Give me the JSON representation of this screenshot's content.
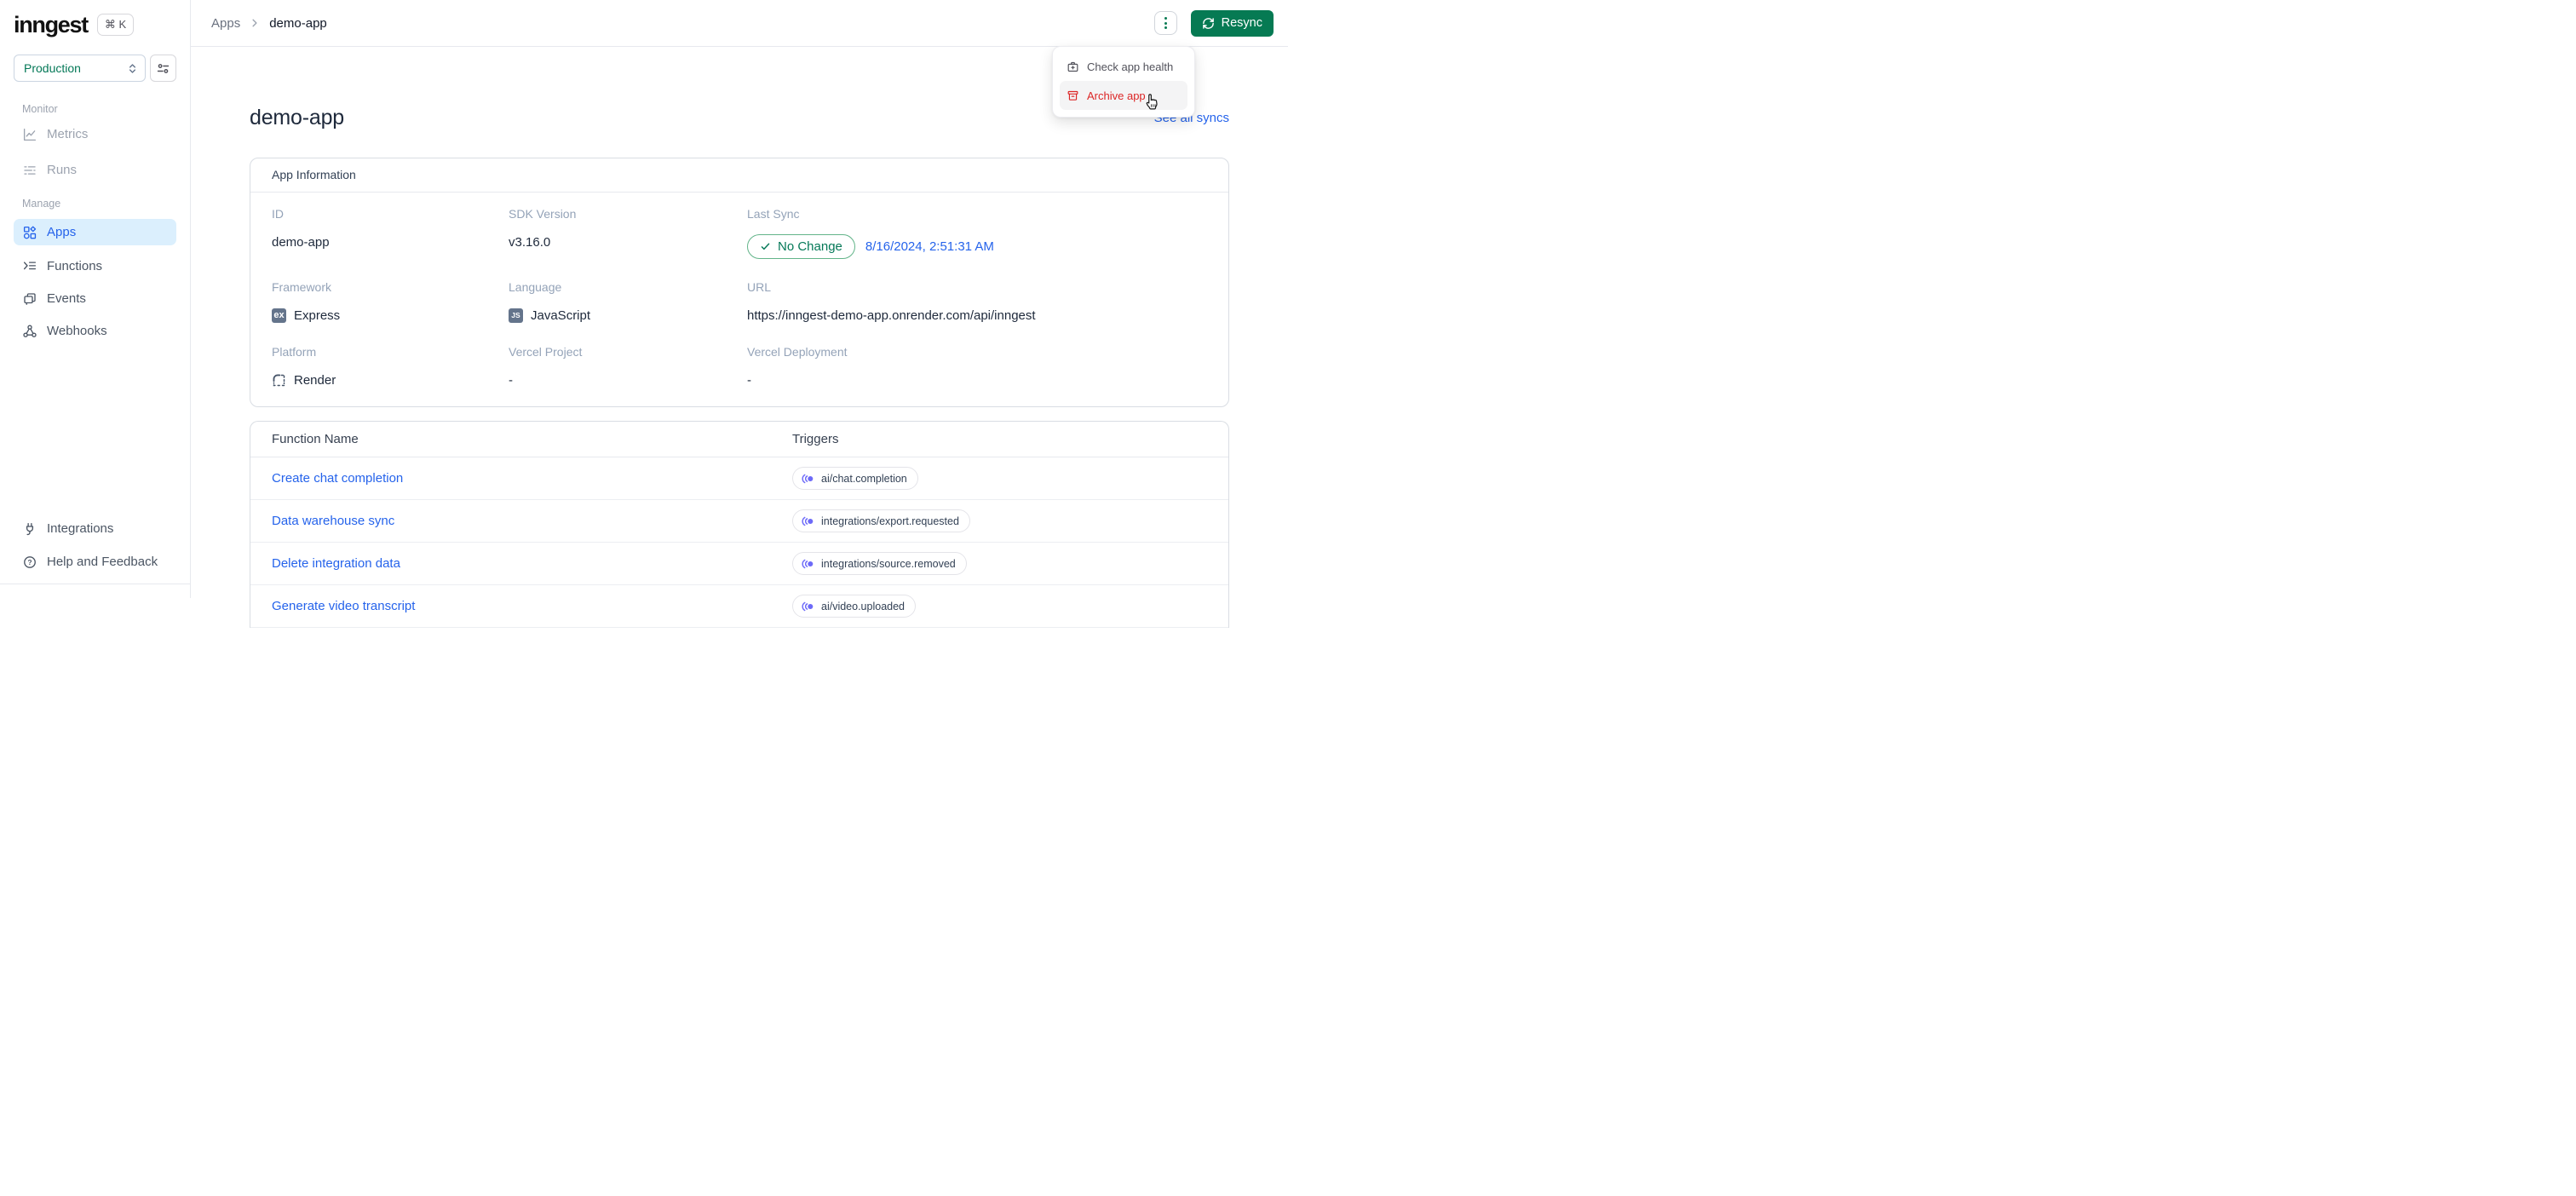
{
  "sidebar": {
    "logo": "inngest",
    "shortcut": "⌘ K",
    "env_selector": {
      "value": "Production"
    },
    "sections": [
      {
        "label": "Monitor",
        "items": [
          {
            "label": "Metrics"
          },
          {
            "label": "Runs"
          }
        ]
      },
      {
        "label": "Manage",
        "items": [
          {
            "label": "Apps"
          },
          {
            "label": "Functions"
          },
          {
            "label": "Events"
          },
          {
            "label": "Webhooks"
          }
        ]
      }
    ],
    "footer_items": [
      {
        "label": "Integrations"
      },
      {
        "label": "Help and Feedback"
      }
    ]
  },
  "header": {
    "breadcrumb": [
      "Apps",
      "demo-app"
    ],
    "resync_label": "Resync"
  },
  "menu": {
    "items": [
      {
        "label": "Check app health"
      },
      {
        "label": "Archive app"
      }
    ]
  },
  "page": {
    "title": "demo-app",
    "see_all_syncs": "See all syncs"
  },
  "app_info": {
    "card_title": "App Information",
    "fields": [
      {
        "label": "ID",
        "value": "demo-app"
      },
      {
        "label": "SDK Version",
        "value": "v3.16.0"
      },
      {
        "label": "Last Sync",
        "badge": "No Change",
        "value": "8/16/2024, 2:51:31 AM"
      },
      {
        "label": "Framework",
        "value": "Express",
        "icon_text": "ex"
      },
      {
        "label": "Language",
        "value": "JavaScript",
        "icon_text": "JS"
      },
      {
        "label": "URL",
        "value": "https://inngest-demo-app.onrender.com/api/inngest"
      },
      {
        "label": "Platform",
        "value": "Render"
      },
      {
        "label": "Vercel Project",
        "value": "-"
      },
      {
        "label": "Vercel Deployment",
        "value": "-"
      }
    ]
  },
  "functions_table": {
    "columns": [
      "Function Name",
      "Triggers"
    ],
    "rows": [
      {
        "name": "Create chat completion",
        "trigger": "ai/chat.completion"
      },
      {
        "name": "Data warehouse sync",
        "trigger": "integrations/export.requested"
      },
      {
        "name": "Delete integration data",
        "trigger": "integrations/source.removed"
      },
      {
        "name": "Generate video transcript",
        "trigger": "ai/video.uploaded"
      }
    ]
  },
  "colors": {
    "brand_green": "#067a53",
    "green_text": "#047857",
    "link_blue": "#2563eb",
    "danger_red": "#dc2626",
    "trigger_indigo": "#6d6af8",
    "active_item_bg": "#dbeffd"
  }
}
